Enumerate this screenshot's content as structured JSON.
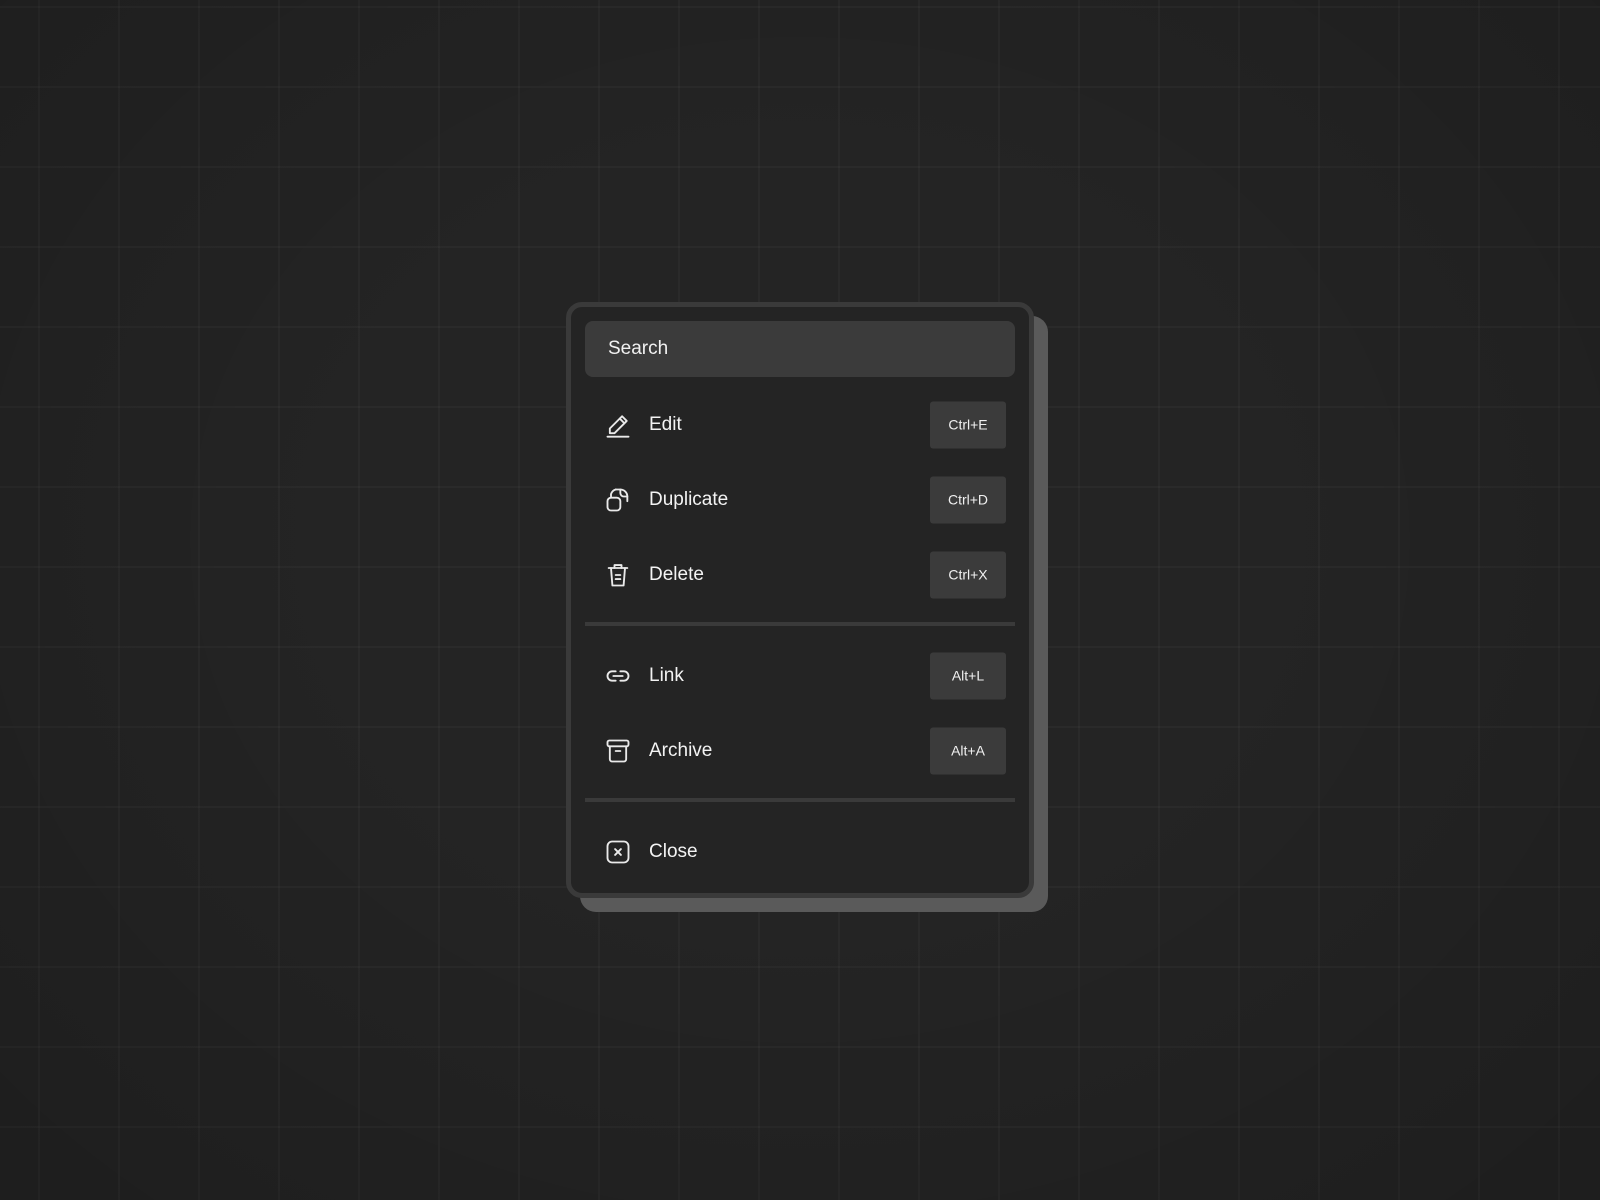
{
  "search": {
    "placeholder": "Search"
  },
  "groups": [
    [
      {
        "label": "Edit",
        "shortcut": "Ctrl+E",
        "icon": "pencil-icon"
      },
      {
        "label": "Duplicate",
        "shortcut": "Ctrl+D",
        "icon": "duplicate-icon"
      },
      {
        "label": "Delete",
        "shortcut": "Ctrl+X",
        "icon": "trash-icon"
      }
    ],
    [
      {
        "label": "Link",
        "shortcut": "Alt+L",
        "icon": "link-icon"
      },
      {
        "label": "Archive",
        "shortcut": "Alt+A",
        "icon": "archive-icon"
      }
    ],
    [
      {
        "label": "Close",
        "icon": "close-icon"
      }
    ]
  ],
  "colors": {
    "background": "#242424",
    "panel": "#242424",
    "panel_border": "#3a3a3a",
    "panel_shadow": "#5a5a5a",
    "field": "#3b3b3b",
    "text": "#f3f3f3"
  }
}
